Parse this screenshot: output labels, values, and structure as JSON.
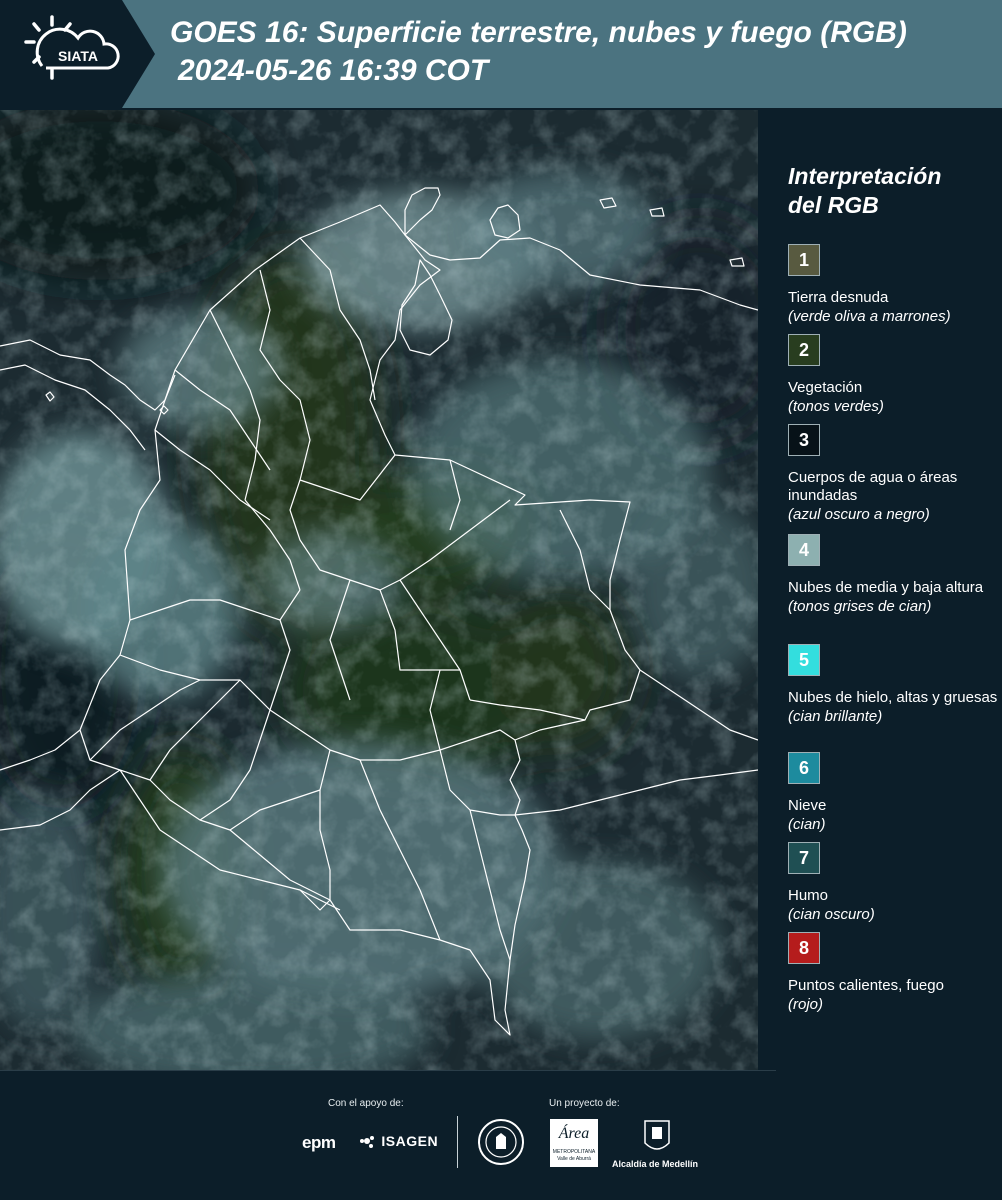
{
  "header": {
    "logo_text": "SIATA",
    "title_line1": "GOES 16: Superficie terrestre, nubes y fuego (RGB)",
    "title_line2": "2024-05-26 16:39 COT"
  },
  "legend": {
    "title_line1": "Interpretación",
    "title_line2": "del RGB",
    "items": [
      {
        "num": "1",
        "label": "Tierra desnuda",
        "sub": "(verde oliva a marrones)",
        "color": "#585a40"
      },
      {
        "num": "2",
        "label": "Vegetación",
        "sub": "(tonos verdes)",
        "color": "#283d1f"
      },
      {
        "num": "3",
        "label": "Cuerpos de agua o áreas inundadas",
        "sub": "(azul oscuro a negro)",
        "color": "#071218"
      },
      {
        "num": "4",
        "label": "Nubes de media y baja altura",
        "sub": "(tonos grises de cian)",
        "color": "#8db0b0"
      },
      {
        "num": "5",
        "label": "Nubes de hielo, altas y gruesas",
        "sub": "(cian brillante)",
        "color": "#33dede"
      },
      {
        "num": "6",
        "label": "Nieve",
        "sub": "(cian)",
        "color": "#1d8b9e"
      },
      {
        "num": "7",
        "label": "Humo",
        "sub": "(cian oscuro)",
        "color": "#1f4f53"
      },
      {
        "num": "8",
        "label": "Puntos calientes, fuego",
        "sub": "(rojo)",
        "color": "#b51c1c"
      }
    ]
  },
  "footer": {
    "support_label": "Con el apoyo de:",
    "project_label": "Un proyecto de:",
    "sponsor_epm": "epm",
    "sponsor_isagen": "ISAGEN",
    "area_word": "Área",
    "area_line1": "METROPOLITANA",
    "area_line2": "Valle de Aburrá",
    "alcaldia": "Alcaldía de Medellín"
  },
  "colors": {
    "header_bg": "#4b7380",
    "page_bg": "#0c1e29",
    "border_lines": "#ffffff"
  }
}
